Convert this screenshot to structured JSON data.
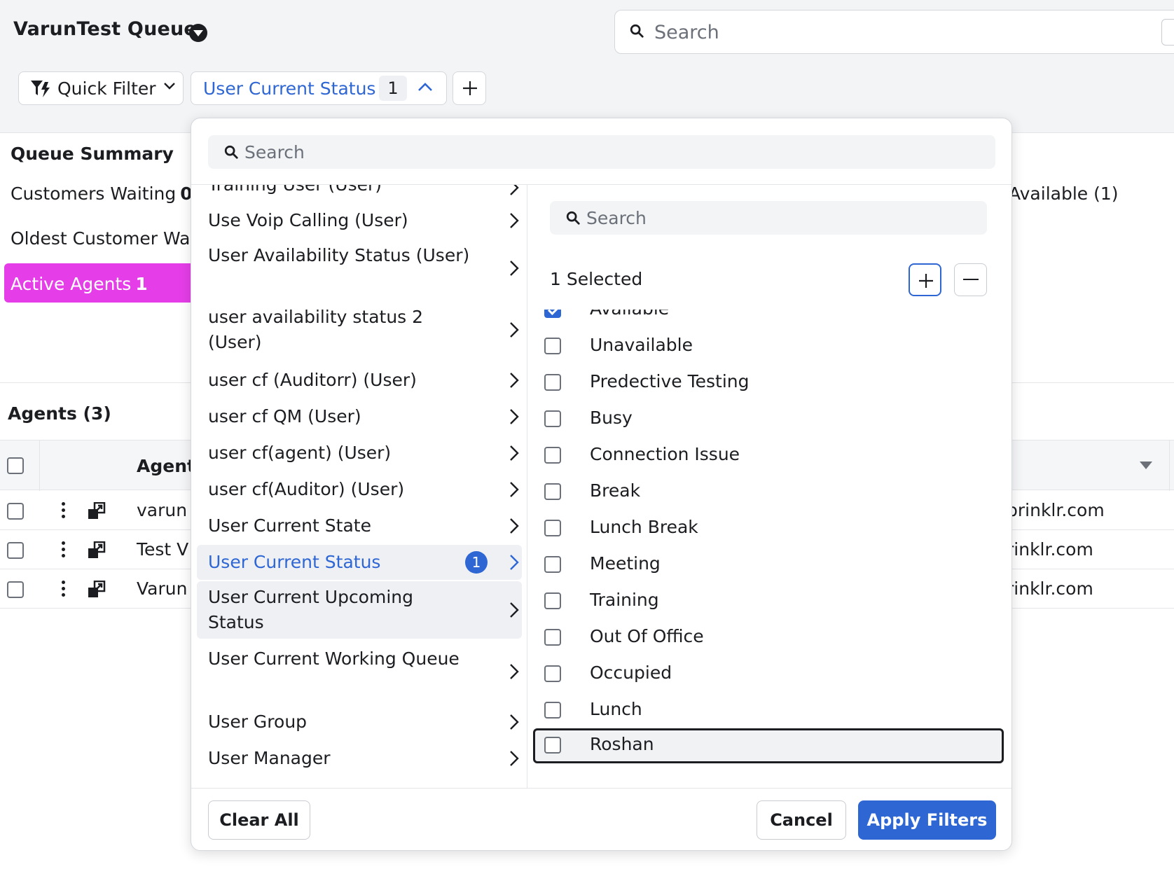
{
  "header": {
    "queue_title": "VarunTest Queue",
    "search_placeholder": "Search"
  },
  "filter_bar": {
    "quick_filter_label": "Quick Filter",
    "active_chip_label": "User Current Status",
    "active_chip_count": "1"
  },
  "summary": {
    "title": "Queue Summary",
    "customers_waiting_label": "Customers Waiting",
    "customers_waiting_value": "0",
    "oldest_customer_label": "Oldest Customer Wai",
    "active_agents_label": "Active Agents",
    "active_agents_value": "1",
    "available_label": "Available (1)"
  },
  "agents": {
    "title": "Agents (3)",
    "column_agent": "Agent",
    "rows": [
      {
        "name": "varun",
        "email": "prinklr.com"
      },
      {
        "name": "Test V",
        "email": "rinklr.com"
      },
      {
        "name": "Varun",
        "email": "rinklr.com"
      }
    ]
  },
  "popup": {
    "search_placeholder": "Search",
    "fields": [
      {
        "label": "Training User (User)"
      },
      {
        "label": "Use Voip Calling (User)"
      },
      {
        "label": "User Availability Status (User)"
      },
      {
        "label": "user availability status 2 (User)"
      },
      {
        "label": "user cf (Auditorr) (User)"
      },
      {
        "label": "user cf QM (User)"
      },
      {
        "label": "user cf(agent) (User)"
      },
      {
        "label": "user cf(Auditor) (User)"
      },
      {
        "label": "User Current State"
      },
      {
        "label": "User Current Status",
        "badge": "1"
      },
      {
        "label": "User Current Upcoming Status"
      },
      {
        "label": "User Current Working Queue"
      },
      {
        "label": "User Group"
      },
      {
        "label": "User Manager"
      }
    ],
    "value_search_placeholder": "Search",
    "selected_text": "1 Selected",
    "values": [
      {
        "label": "Available",
        "checked": true
      },
      {
        "label": "Unavailable",
        "checked": false
      },
      {
        "label": "Predective Testing",
        "checked": false
      },
      {
        "label": "Busy",
        "checked": false
      },
      {
        "label": "Connection Issue",
        "checked": false
      },
      {
        "label": "Break",
        "checked": false
      },
      {
        "label": "Lunch Break",
        "checked": false
      },
      {
        "label": "Meeting",
        "checked": false
      },
      {
        "label": "Training",
        "checked": false
      },
      {
        "label": "Out Of Office",
        "checked": false
      },
      {
        "label": "Occupied",
        "checked": false
      },
      {
        "label": "Lunch",
        "checked": false
      },
      {
        "label": "Roshan",
        "checked": false
      }
    ],
    "clear_all_label": "Clear All",
    "cancel_label": "Cancel",
    "apply_label": "Apply Filters"
  },
  "colors": {
    "accent": "#2e66d4",
    "active_agents_bg": "#e53ee8"
  }
}
